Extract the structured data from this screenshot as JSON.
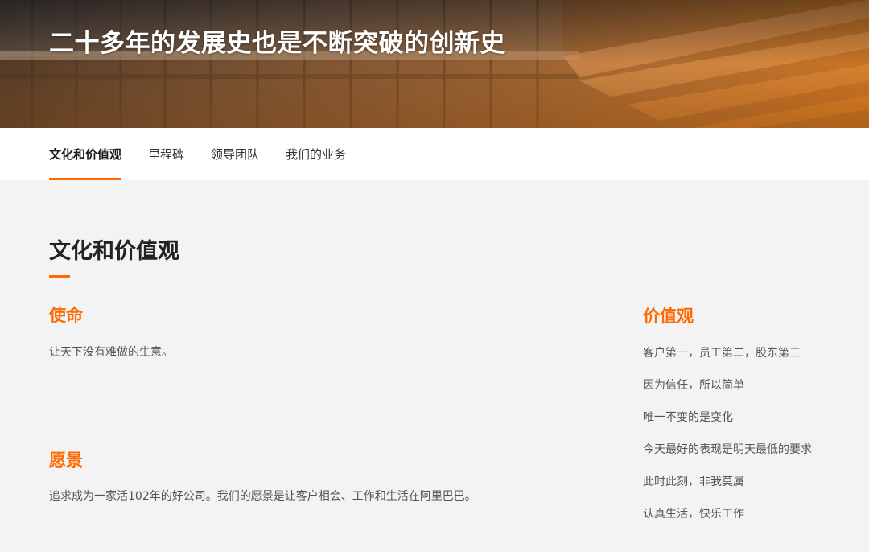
{
  "hero": {
    "title": "二十多年的发展史也是不断突破的创新史"
  },
  "tabs": [
    {
      "label": "文化和价值观",
      "active": true
    },
    {
      "label": "里程碑",
      "active": false
    },
    {
      "label": "领导团队",
      "active": false
    },
    {
      "label": "我们的业务",
      "active": false
    }
  ],
  "section": {
    "title": "文化和价值观",
    "mission": {
      "heading": "使命",
      "text": "让天下没有难做的生意。"
    },
    "vision": {
      "heading": "愿景",
      "text": "追求成为一家活102年的好公司。我们的愿景是让客户相会、工作和生活在阿里巴巴。"
    },
    "values": {
      "heading": "价值观",
      "items": [
        "客户第一，员工第二，股东第三",
        "因为信任，所以简单",
        "唯一不变的是变化",
        "今天最好的表现是明天最低的要求",
        "此时此刻，非我莫属",
        "认真生活，快乐工作"
      ]
    }
  },
  "colors": {
    "accent": "#ff6a00",
    "background": "#f3f3f3",
    "tab_bar": "#ffffff"
  }
}
